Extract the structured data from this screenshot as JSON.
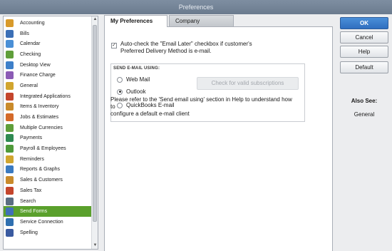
{
  "window": {
    "title": "Preferences"
  },
  "sidebar": {
    "items": [
      {
        "label": "Accounting",
        "icon": "accounting-icon",
        "color": "#d89a2b"
      },
      {
        "label": "Bills",
        "icon": "bills-icon",
        "color": "#3b6fb6"
      },
      {
        "label": "Calendar",
        "icon": "calendar-icon",
        "color": "#4a8fd6"
      },
      {
        "label": "Checking",
        "icon": "checking-icon",
        "color": "#5f9e3a"
      },
      {
        "label": "Desktop View",
        "icon": "desktop-view-icon",
        "color": "#3d7fc9"
      },
      {
        "label": "Finance Charge",
        "icon": "finance-charge-icon",
        "color": "#8b5bb5"
      },
      {
        "label": "General",
        "icon": "general-icon",
        "color": "#d1a52e"
      },
      {
        "label": "Integrated Applications",
        "icon": "integrated-apps-icon",
        "color": "#c4452c"
      },
      {
        "label": "Items & Inventory",
        "icon": "items-inventory-icon",
        "color": "#c98a2a"
      },
      {
        "label": "Jobs & Estimates",
        "icon": "jobs-estimates-icon",
        "color": "#d46a2a"
      },
      {
        "label": "Multiple Currencies",
        "icon": "currencies-icon",
        "color": "#5f9e3a"
      },
      {
        "label": "Payments",
        "icon": "payments-icon",
        "color": "#2f8a52"
      },
      {
        "label": "Payroll & Employees",
        "icon": "payroll-icon",
        "color": "#4f9a3a"
      },
      {
        "label": "Reminders",
        "icon": "reminders-icon",
        "color": "#d1a52e"
      },
      {
        "label": "Reports & Graphs",
        "icon": "reports-graphs-icon",
        "color": "#3a7ac0"
      },
      {
        "label": "Sales & Customers",
        "icon": "sales-customers-icon",
        "color": "#c98a2a"
      },
      {
        "label": "Sales Tax",
        "icon": "sales-tax-icon",
        "color": "#c4452c"
      },
      {
        "label": "Search",
        "icon": "search-icon",
        "color": "#5a6d82"
      },
      {
        "label": "Send Forms",
        "icon": "send-forms-icon",
        "color": "#3f6fb8",
        "selected": true
      },
      {
        "label": "Service Connection",
        "icon": "service-connection-icon",
        "color": "#2f6fb0"
      },
      {
        "label": "Spelling",
        "icon": "spelling-icon",
        "color": "#3a5aa0"
      }
    ]
  },
  "tabs": {
    "my_label": "My Preferences",
    "company_label": "Company Preferences"
  },
  "my_prefs": {
    "auto_check_line1": "Auto-check the \"Email Later\" checkbox if customer's",
    "auto_check_line2": "Preferred Delivery Method is e-mail.",
    "auto_check_checked": true,
    "group_title": "SEND E-MAIL USING:",
    "options": [
      {
        "label": "Web Mail",
        "selected": false
      },
      {
        "label": "Outlook",
        "selected": true
      },
      {
        "label": "QuickBooks E-mail",
        "selected": false
      }
    ],
    "check_button": "Check for valid subscriptions",
    "note_line1": "Please refer to the 'Send email using' section in Help to understand how to",
    "note_line2": "configure a default e-mail client"
  },
  "buttons": {
    "ok": "OK",
    "cancel": "Cancel",
    "help": "Help",
    "default": "Default"
  },
  "also_see": {
    "title": "Also See:",
    "link": "General"
  }
}
